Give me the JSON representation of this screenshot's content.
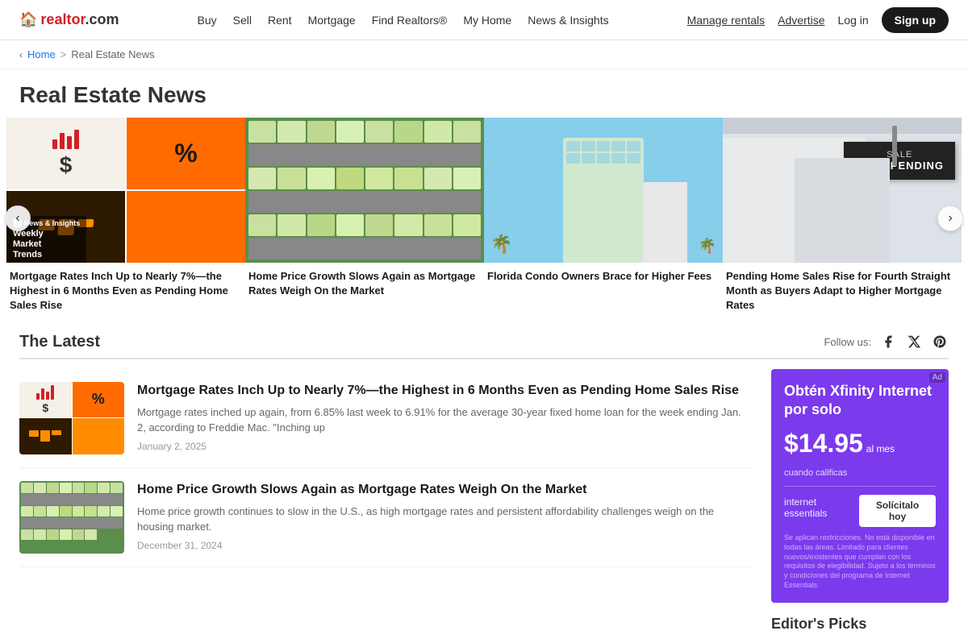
{
  "brand": {
    "name": "realtor.com",
    "logo_icon": "🏠"
  },
  "nav": {
    "links": [
      "Buy",
      "Sell",
      "Rent",
      "Mortgage",
      "Find Realtors®",
      "My Home",
      "News & Insights"
    ],
    "right_links": [
      "Manage rentals",
      "Advertise"
    ],
    "login": "Log in",
    "signup": "Sign up"
  },
  "breadcrumb": {
    "home": "Home",
    "sep": ">",
    "current": "Real Estate News"
  },
  "page_title": "Real Estate News",
  "carousel": {
    "items": [
      {
        "id": "item1",
        "type": "weekly_market",
        "overlay_line1": "Weekly",
        "overlay_line2": "Market",
        "overlay_line3": "Trends",
        "caption": "Mortgage Rates Inch Up to Nearly 7%—the Highest in 6 Months Even as Pending Home Sales Rise"
      },
      {
        "id": "item2",
        "type": "aerial",
        "caption": "Home Price Growth Slows Again as Mortgage Rates Weigh On the Market"
      },
      {
        "id": "item3",
        "type": "building",
        "caption": "Florida Condo Owners Brace for Higher Fees"
      },
      {
        "id": "item4",
        "type": "sale_pending",
        "sign_text": "SALE PENDING",
        "caption": "Pending Home Sales Rise for Fourth Straight Month as Buyers Adapt to Higher Mortgage Rates"
      }
    ]
  },
  "latest": {
    "title": "The Latest",
    "follow_label": "Follow us:",
    "articles": [
      {
        "id": "article1",
        "type": "weekly",
        "title": "Mortgage Rates Inch Up to Nearly 7%—the Highest in 6 Months Even as Pending Home Sales Rise",
        "excerpt": "Mortgage rates inched up again, from 6.85% last week to 6.91% for the average 30-year fixed home loan for the week ending Jan. 2, according to Freddie Mac. \"Inching up",
        "date": "January 2, 2025"
      },
      {
        "id": "article2",
        "type": "aerial",
        "title": "Home Price Growth Slows Again as Mortgage Rates Weigh On the Market",
        "excerpt": "Home price growth continues to slow in the U.S., as high mortgage rates and persistent affordability challenges weigh on the housing market.",
        "date": "December 31, 2024"
      }
    ]
  },
  "ad": {
    "label": "Ad",
    "headline": "Obtén Xfinity Internet por solo",
    "price": "$14.95",
    "price_unit": "al mes",
    "when": "cuando calificas",
    "divider": true,
    "internet_label": "internet essentials",
    "cta_button": "Solícitalo hoy",
    "disclaimer": "Se aplican restricciones. No está disponible en todas las áreas. Limitado para clientes nuevos/existentes que cumplan con los requisitos de elegibilidad. Sujeto a los términos y condiciones del programa de Internet Essentials."
  },
  "editors_picks": {
    "title": "Editor's Picks"
  }
}
